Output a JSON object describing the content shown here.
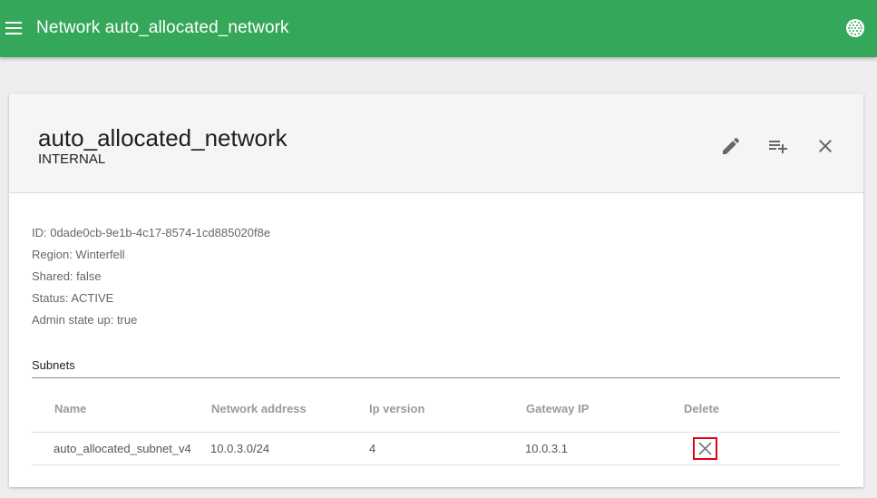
{
  "topbar": {
    "title": "Network auto_allocated_network",
    "menu_icon": "hamburger-menu-icon",
    "globe_icon": "globe-icon"
  },
  "network": {
    "name": "auto_allocated_network",
    "type": "INTERNAL",
    "actions": {
      "edit_icon": "pencil-icon",
      "add_subnet_icon": "playlist-add-icon",
      "close_icon": "close-icon"
    },
    "details": {
      "id": "ID: 0dade0cb-9e1b-4c17-8574-1cd885020f8e",
      "region": "Region: Winterfell",
      "shared": "Shared: false",
      "status": "Status: ACTIVE",
      "admin_state": "Admin state up: true"
    }
  },
  "subnets": {
    "label": "Subnets",
    "columns": [
      "Name",
      "Network address",
      "Ip version",
      "Gateway IP",
      "Delete"
    ],
    "rows": [
      {
        "name": "auto_allocated_subnet_v4",
        "network_address": "10.0.3.0/24",
        "ip_version": "4",
        "gateway_ip": "10.0.3.1",
        "delete_icon": "close-icon"
      }
    ]
  },
  "colors": {
    "topbar": "#34a75a",
    "delete_highlight": "#e0001a"
  }
}
